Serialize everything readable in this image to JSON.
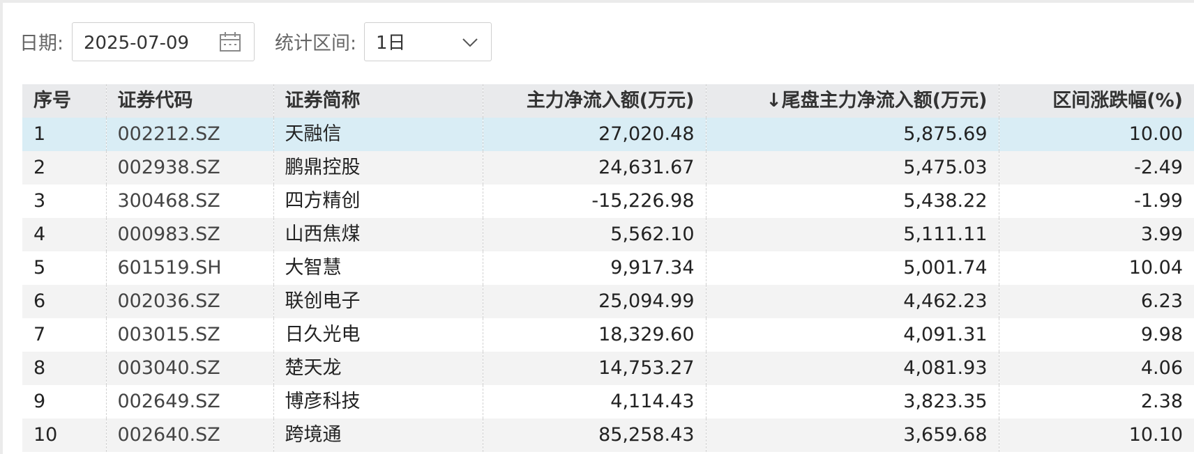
{
  "filters": {
    "date_label": "日期:",
    "date_value": "2025-07-09",
    "range_label": "统计区间:",
    "range_value": "1日"
  },
  "table": {
    "headers": [
      "序号",
      "证券代码",
      "证券简称",
      "主力净流入额(万元)",
      "↓尾盘主力净流入额(万元)",
      "区间涨跌幅(%)"
    ],
    "rows": [
      [
        "1",
        "002212.SZ",
        "天融信",
        "27,020.48",
        "5,875.69",
        "10.00"
      ],
      [
        "2",
        "002938.SZ",
        "鹏鼎控股",
        "24,631.67",
        "5,475.03",
        "-2.49"
      ],
      [
        "3",
        "300468.SZ",
        "四方精创",
        "-15,226.98",
        "5,438.22",
        "-1.99"
      ],
      [
        "4",
        "000983.SZ",
        "山西焦煤",
        "5,562.10",
        "5,111.11",
        "3.99"
      ],
      [
        "5",
        "601519.SH",
        "大智慧",
        "9,917.34",
        "5,001.74",
        "10.04"
      ],
      [
        "6",
        "002036.SZ",
        "联创电子",
        "25,094.99",
        "4,462.23",
        "6.23"
      ],
      [
        "7",
        "003015.SZ",
        "日久光电",
        "18,329.60",
        "4,091.31",
        "9.98"
      ],
      [
        "8",
        "003040.SZ",
        "楚天龙",
        "14,753.27",
        "4,081.93",
        "4.06"
      ],
      [
        "9",
        "002649.SZ",
        "博彦科技",
        "4,114.43",
        "3,823.35",
        "2.38"
      ],
      [
        "10",
        "002640.SZ",
        "跨境通",
        "85,258.43",
        "3,659.68",
        "10.10"
      ]
    ]
  }
}
